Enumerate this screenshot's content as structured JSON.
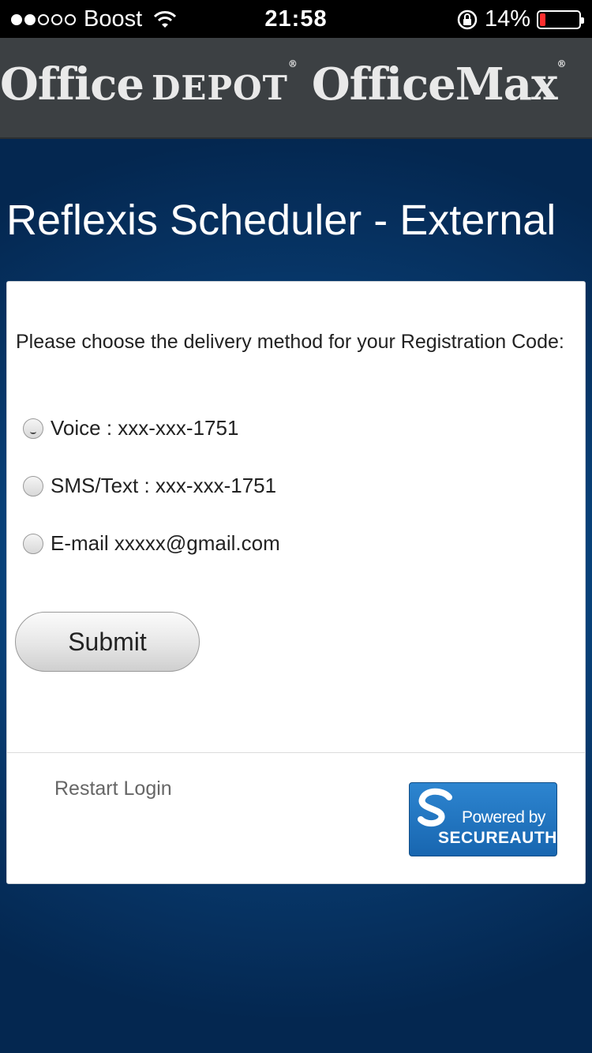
{
  "status_bar": {
    "carrier": "Boost",
    "time": "21:58",
    "battery_percent_label": "14%",
    "battery_level": 0.14,
    "signal_bars_filled": 2,
    "signal_bars_total": 5,
    "icons": [
      "wifi-icon",
      "rotation-lock-icon",
      "battery-icon"
    ]
  },
  "header": {
    "brand_part1": "Office",
    "brand_part2": "DEPOT",
    "brand_part3": "OfficeMax",
    "trademark": "®",
    "background": "#3c4043"
  },
  "title": "Reflexis Scheduler - External",
  "form": {
    "prompt": "Please choose the delivery method for your Registration Code:",
    "options": [
      {
        "label": "Voice : xxx-xxx-1751",
        "selected": true
      },
      {
        "label": "SMS/Text : xxx-xxx-1751",
        "selected": false
      },
      {
        "label": "E-mail xxxxx@gmail.com",
        "selected": false
      }
    ],
    "submit_label": "Submit"
  },
  "footer": {
    "restart_label": "Restart Login",
    "secureauth_powered": "Powered by",
    "secureauth_brand": "SECUREAUTH",
    "secureauth_tm": "®"
  },
  "colors": {
    "background_blue": "#0a4f8f",
    "header_gray": "#3c4043",
    "battery_low": "#ff2d2d",
    "secureauth_blue": "#1866b0"
  }
}
